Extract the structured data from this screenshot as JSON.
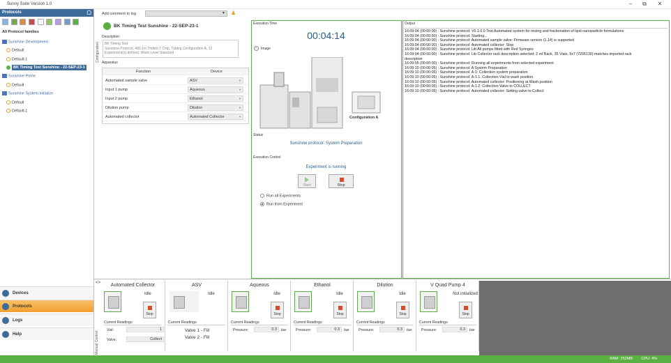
{
  "window": {
    "title": "Sunny Suite Version 1.0",
    "min": "–",
    "max": "⧉",
    "close": "✕"
  },
  "protocols_panel": {
    "header": "Protocols",
    "pin": "▢",
    "families_label": "All Protocol families",
    "tree": [
      {
        "label": "Sunshine Development",
        "type": "group"
      },
      {
        "label": "Default",
        "type": "item"
      },
      {
        "label": "Default-1",
        "type": "item"
      },
      {
        "label": "BK Timing Test Sunshine - 22-SEP-23-1",
        "type": "selected"
      },
      {
        "label": "Sunshine Prime",
        "type": "group"
      },
      {
        "label": "Default",
        "type": "item"
      },
      {
        "label": "Sunshine System Initialize",
        "type": "group"
      },
      {
        "label": "Default",
        "type": "item"
      },
      {
        "label": "Default-1",
        "type": "item"
      }
    ]
  },
  "nav": [
    {
      "label": "Devices",
      "active": false
    },
    {
      "label": "Protocols",
      "active": true
    },
    {
      "label": "Logs",
      "active": false
    },
    {
      "label": "Help",
      "active": false
    }
  ],
  "toolbar": {
    "comment_label": "Add comment to log",
    "combo_value": ""
  },
  "config": {
    "side_tab": "Configuration",
    "protocol_title": "BK Timing Test Sunshine - 22-SEP-23-1",
    "description_label": "Description",
    "description_lines": [
      "BK Timing Test",
      "Sunshine Protocol, 480.1m Trident T Chip, Tubing Configuration A, 12",
      "Experiment(s) defined, Wash Level Standard"
    ],
    "apparatus_label": "Apparatus",
    "col_function": "Function",
    "col_device": "Device",
    "rows": [
      {
        "function": "Automated sample valve",
        "device": "ASV"
      },
      {
        "function": "Input 1 pump",
        "device": "Aqueous"
      },
      {
        "function": "Input 2 pump",
        "device": "Ethanol"
      },
      {
        "function": "Dilution pump",
        "device": "Dilution"
      },
      {
        "function": "Automated collector",
        "device": "Automated Collector"
      }
    ]
  },
  "execution": {
    "time_label": "Execution Time",
    "time_value": "00:04:14",
    "image_label": "Image",
    "config_caption": "Configuration A",
    "status_label": "Status",
    "status_text": "Sunshine protocol: System Preparation",
    "control_label": "Execution Control",
    "running_text": "Experiment is running",
    "start_label": "Start",
    "stop_label": "Stop",
    "run_all_label": "Run all Experiments",
    "run_from_label": "Run from Experiment"
  },
  "output": {
    "label": "Output",
    "lines": [
      "16:09:04 (00:00:00) : Sunshine protocol: V0.1.0.0 Test Automated system for mixing and fractionation of lipid nanoparticle formulations",
      "16:09:04 (00:00:00) : Sunshine protocol: Starting...",
      "16:09:04 (00:00:00) : Sunshine protocol: Automated sample valve: Firmware version (1.14) is supported",
      "16:09:04 (00:00:00) : Sunshine protocol: Automated collector: Stop",
      "16:09:04 (00:00:00) : Sunshine protocol: Lib All pumps fitted with Red Syringes",
      "16:09:04 (00:00:00) : Sunshine protocol: Lib Collector rack description selected: 2 ml Rack, 35 Vials, 5x7 (7206130) matches imported rack",
      "description",
      "16:09:05 (00:00:00) : Sunshine protocol: Running all experiments from selected experiment",
      "16:09:10 (00:00:05) : Sunshine protocol: A System Preparation",
      "16:09:10 (00:00:05) : Sunshine protocol: A-1: Collection system preparation",
      "16:09:10 (00:00:05) : Sunshine protocol: A-1.1: Collection Vial to wash position",
      "16:09:10 (00:00:05) : Sunshine protocol: Automated collector: Positioning at Wash position",
      "16:09:10 (00:00:05) : Sunshine protocol: A-1.2: Collection Valve to COLLECT",
      "16:09:10 (00:00:05) : Sunshine protocol: Automated collector: Setting valve to Collect"
    ]
  },
  "manual_control": {
    "side_tab": "Manual Control",
    "devices": [
      {
        "title": "Automated Collector",
        "status": "Idle",
        "stop": "Stop",
        "readings": "Current Readings",
        "fields": [
          {
            "label": "Vial:",
            "value": "1"
          },
          {
            "label": "Valve:",
            "value": "Collect"
          }
        ]
      },
      {
        "title": "ASV",
        "status": "Idle",
        "valve1": "Valve 1 - Fill",
        "valve2": "Valve 2 - Fill",
        "readings": "Current Readings"
      },
      {
        "title": "Aqueous",
        "status": "Idle",
        "stop": "Stop",
        "readings": "Current Readings",
        "pressure_label": "Pressure:",
        "pressure": "0.3",
        "unit": "bar"
      },
      {
        "title": "Ethanol",
        "status": "Idle",
        "stop": "Stop",
        "readings": "Current Readings",
        "pressure_label": "Pressure:",
        "pressure": "0.3",
        "unit": "bar"
      },
      {
        "title": "Dilution",
        "status": "Idle",
        "stop": "Stop",
        "readings": "Current Readings",
        "pressure_label": "Pressure:",
        "pressure": "0.3",
        "unit": "bar"
      },
      {
        "title": "V Quad Pump 4",
        "status": "Not initialized",
        "stop": "Stop",
        "readings": "Current Readings",
        "pressure_label": "Pressure:",
        "pressure": "0.3",
        "unit": "bar"
      }
    ]
  },
  "statusbar": {
    "ram": "RAM: 252MB",
    "cpu": "CPU: 4%"
  },
  "colors": {
    "accent_green": "#5ab043",
    "header_blue": "#3e6b9a",
    "active_nav": "#f0a030",
    "stop_red": "#d84a2a",
    "time_blue": "#2a5d8a"
  }
}
